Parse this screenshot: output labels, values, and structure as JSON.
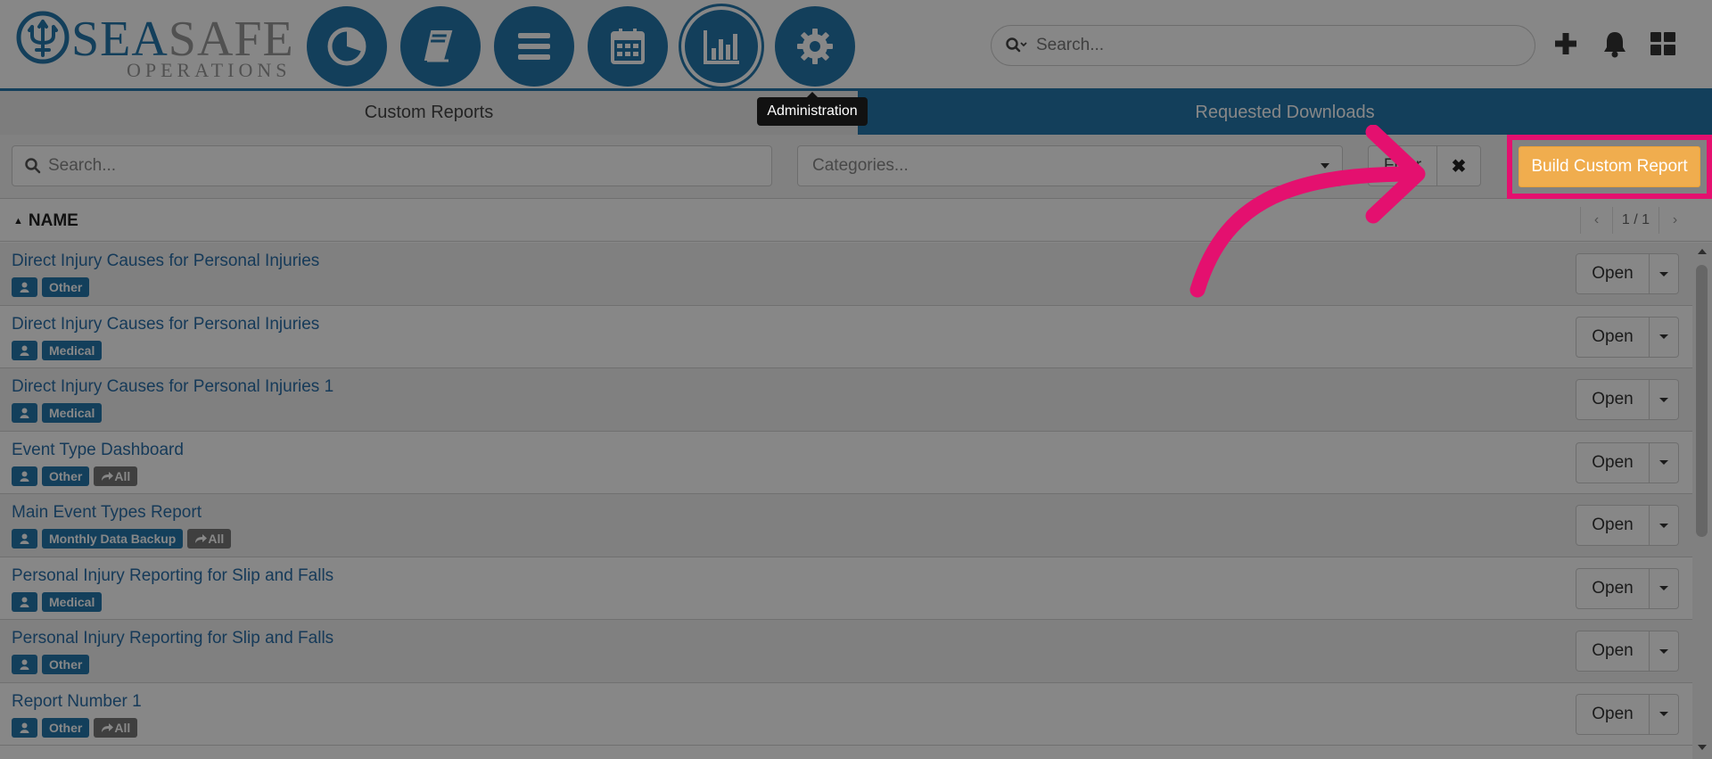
{
  "app": {
    "logo": {
      "sea": "SEA",
      "safe": "SAFE",
      "tagline": "OPERATIONS"
    },
    "nav": [
      {
        "name": "dashboard",
        "icon": "pie-chart-icon"
      },
      {
        "name": "logbook",
        "icon": "book-icon"
      },
      {
        "name": "menu",
        "icon": "list-icon"
      },
      {
        "name": "calendar",
        "icon": "calendar-icon"
      },
      {
        "name": "reports",
        "icon": "bar-chart-icon"
      },
      {
        "name": "administration",
        "icon": "gear-icon"
      }
    ],
    "search_placeholder": "Search...",
    "header_icons": [
      "plus-icon",
      "bell-icon",
      "grid-icon"
    ]
  },
  "tooltip": {
    "text": "Administration"
  },
  "tabs": {
    "custom": "Custom Reports",
    "requested": "Requested Downloads"
  },
  "toolbar": {
    "search_placeholder": "Search...",
    "categories_placeholder": "Categories...",
    "filter_label": "Filter",
    "clear_label": "✖",
    "build_label": "Build Custom Report"
  },
  "list": {
    "column": "NAME",
    "pager": "1 / 1",
    "open_label": "Open",
    "reports": [
      {
        "title": "Direct Injury Causes for Personal Injuries",
        "category": "Other",
        "shared": ""
      },
      {
        "title": "Direct Injury Causes for Personal Injuries",
        "category": "Medical",
        "shared": ""
      },
      {
        "title": "Direct Injury Causes for Personal Injuries 1",
        "category": "Medical",
        "shared": ""
      },
      {
        "title": "Event Type Dashboard",
        "category": "Other",
        "shared": "All"
      },
      {
        "title": "Main Event Types Report",
        "category": "Monthly Data Backup",
        "shared": "All"
      },
      {
        "title": "Personal Injury Reporting for Slip and Falls",
        "category": "Medical",
        "shared": ""
      },
      {
        "title": "Personal Injury Reporting for Slip and Falls",
        "category": "Other",
        "shared": ""
      },
      {
        "title": "Report Number 1",
        "category": "Other",
        "shared": "All"
      }
    ]
  },
  "colors": {
    "brand_blue": "#2577ad",
    "build_orange": "#f0ad4e",
    "highlight_pink": "#e4106f",
    "link_blue": "#2a6fa8"
  }
}
